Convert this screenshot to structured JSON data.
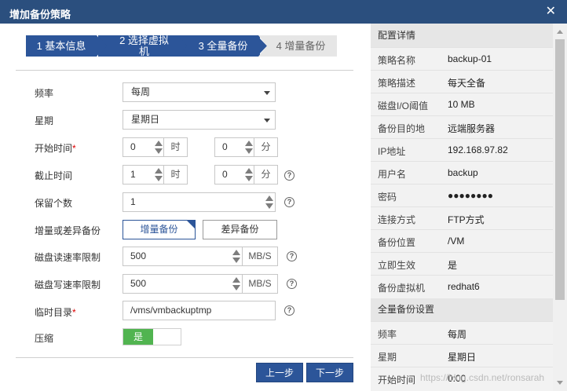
{
  "dialog": {
    "title": "增加备份策略",
    "close": "✕"
  },
  "steps": [
    {
      "label": "1 基本信息",
      "state": "done"
    },
    {
      "label": "2 选择虚拟机",
      "state": "done"
    },
    {
      "label": "3 全量备份",
      "state": "current"
    },
    {
      "label": "4 增量备份",
      "state": "todo"
    }
  ],
  "form": {
    "frequency": {
      "label": "频率",
      "value": "每周"
    },
    "weekday": {
      "label": "星期",
      "value": "星期日"
    },
    "start_time": {
      "label": "开始时间",
      "required": "*",
      "hour": "0",
      "hour_unit": "时",
      "minute": "0",
      "minute_unit": "分"
    },
    "end_time": {
      "label": "截止时间",
      "hour": "1",
      "hour_unit": "时",
      "minute": "0",
      "minute_unit": "分",
      "help": "?"
    },
    "retain_count": {
      "label": "保留个数",
      "value": "1",
      "help": "?"
    },
    "incr_or_diff": {
      "label": "增量或差异备份",
      "options": [
        "增量备份",
        "差异备份"
      ],
      "selected": "增量备份"
    },
    "disk_read_limit": {
      "label": "磁盘读速率限制",
      "value": "500",
      "unit": "MB/S",
      "help": "?"
    },
    "disk_write_limit": {
      "label": "磁盘写速率限制",
      "value": "500",
      "unit": "MB/S",
      "help": "?"
    },
    "temp_dir": {
      "label": "临时目录",
      "required": "*",
      "value": "/vms/vmbackuptmp",
      "help": "?"
    },
    "compress": {
      "label": "压缩",
      "value": "是",
      "color": "#51b450"
    }
  },
  "buttons": {
    "prev": "上一步",
    "next": "下一步"
  },
  "summary": {
    "title": "配置详情",
    "rows": [
      {
        "k": "策略名称",
        "v": "backup-01"
      },
      {
        "k": "策略描述",
        "v": "每天全备"
      },
      {
        "k": "磁盘I/O阈值",
        "v": "10 MB"
      },
      {
        "k": "备份目的地",
        "v": "远端服务器"
      },
      {
        "k": "IP地址",
        "v": "192.168.97.82"
      },
      {
        "k": "用户名",
        "v": "backup"
      },
      {
        "k": "密码",
        "v": "●●●●●●●●"
      },
      {
        "k": "连接方式",
        "v": "FTP方式"
      },
      {
        "k": "备份位置",
        "v": "/VM"
      },
      {
        "k": "立即生效",
        "v": "是"
      },
      {
        "k": "备份虚拟机",
        "v": "redhat6"
      }
    ],
    "section2": "全量备份设置",
    "rows2": [
      {
        "k": "频率",
        "v": "每周"
      },
      {
        "k": "星期",
        "v": "星期日"
      },
      {
        "k": "开始时间",
        "v": "0:00"
      }
    ]
  },
  "watermark": "https://blog.csdn.net/ronsarah",
  "colors": {
    "titlebar": "#2b4f7e",
    "accent": "#2c5599",
    "toggle_on": "#51b450"
  }
}
